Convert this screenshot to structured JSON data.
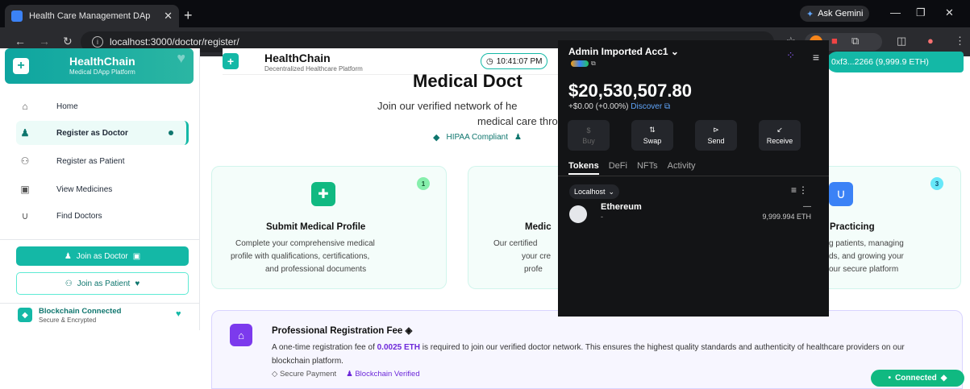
{
  "browser": {
    "tab_title": "Health Care Management DAp",
    "gemini": "Ask Gemini",
    "url": "localhost:3000/doctor/register/"
  },
  "sidebar": {
    "brand": "HealthChain",
    "tagline": "Medical DApp Platform",
    "items": [
      {
        "label": "Home",
        "icon": "home-icon"
      },
      {
        "label": "Register as Doctor",
        "icon": "doctor-icon"
      },
      {
        "label": "Register as Patient",
        "icon": "patient-icon"
      },
      {
        "label": "View Medicines",
        "icon": "medicine-icon"
      },
      {
        "label": "Find Doctors",
        "icon": "stethoscope-icon"
      }
    ],
    "join_doctor": "Join as Doctor",
    "join_patient": "Join as Patient",
    "chain_status": "Blockchain Connected",
    "chain_sub": "Secure & Encrypted"
  },
  "header": {
    "brand": "HealthChain",
    "subtitle": "Decentralized Healthcare Platform",
    "time": "10:41:07 PM",
    "address": "0xf3...2266 (9,999.9 ETH)"
  },
  "hero": {
    "title": "Medical Doct",
    "line1": "Join our verified network of he",
    "line2": "medical care thro",
    "badge": "HIPAA Compliant"
  },
  "cards": [
    {
      "badge": "1",
      "title": "Submit Medical Profile",
      "lines": [
        "Complete your comprehensive medical",
        "profile with qualifications, certifications,",
        "and professional documents"
      ]
    },
    {
      "title": "Medic",
      "lines": [
        "Our certified",
        "your cre",
        "profe"
      ]
    },
    {
      "badge": "3",
      "title": "Practicing",
      "lines": [
        "g patients, managing",
        "ds, and growing your",
        "our secure platform"
      ]
    }
  ],
  "fee": {
    "title": "Professional Registration Fee",
    "body_pre": "A one-time registration fee of ",
    "amount": "0.0025 ETH",
    "body_post": " is required to join our verified doctor network. This ensures the highest quality standards and authenticity of healthcare providers on our blockchain platform.",
    "secure": "Secure Payment",
    "verified": "Blockchain Verified"
  },
  "connected": "Connected",
  "wallet": {
    "account": "Admin Imported Acc1",
    "balance": "$20,530,507.80",
    "change": "+$0.00 (+0.00%)",
    "discover": "Discover",
    "actions": [
      {
        "label": "Buy",
        "icon": "$"
      },
      {
        "label": "Swap",
        "icon": "⇅"
      },
      {
        "label": "Send",
        "icon": "⊳"
      },
      {
        "label": "Receive",
        "icon": "↙"
      }
    ],
    "tabs": [
      "Tokens",
      "DeFi",
      "NFTs",
      "Activity"
    ],
    "network": "Localhost",
    "token": {
      "name": "Ethereum",
      "sub": "-",
      "value": "9,999.994 ETH",
      "delta": "—"
    }
  }
}
